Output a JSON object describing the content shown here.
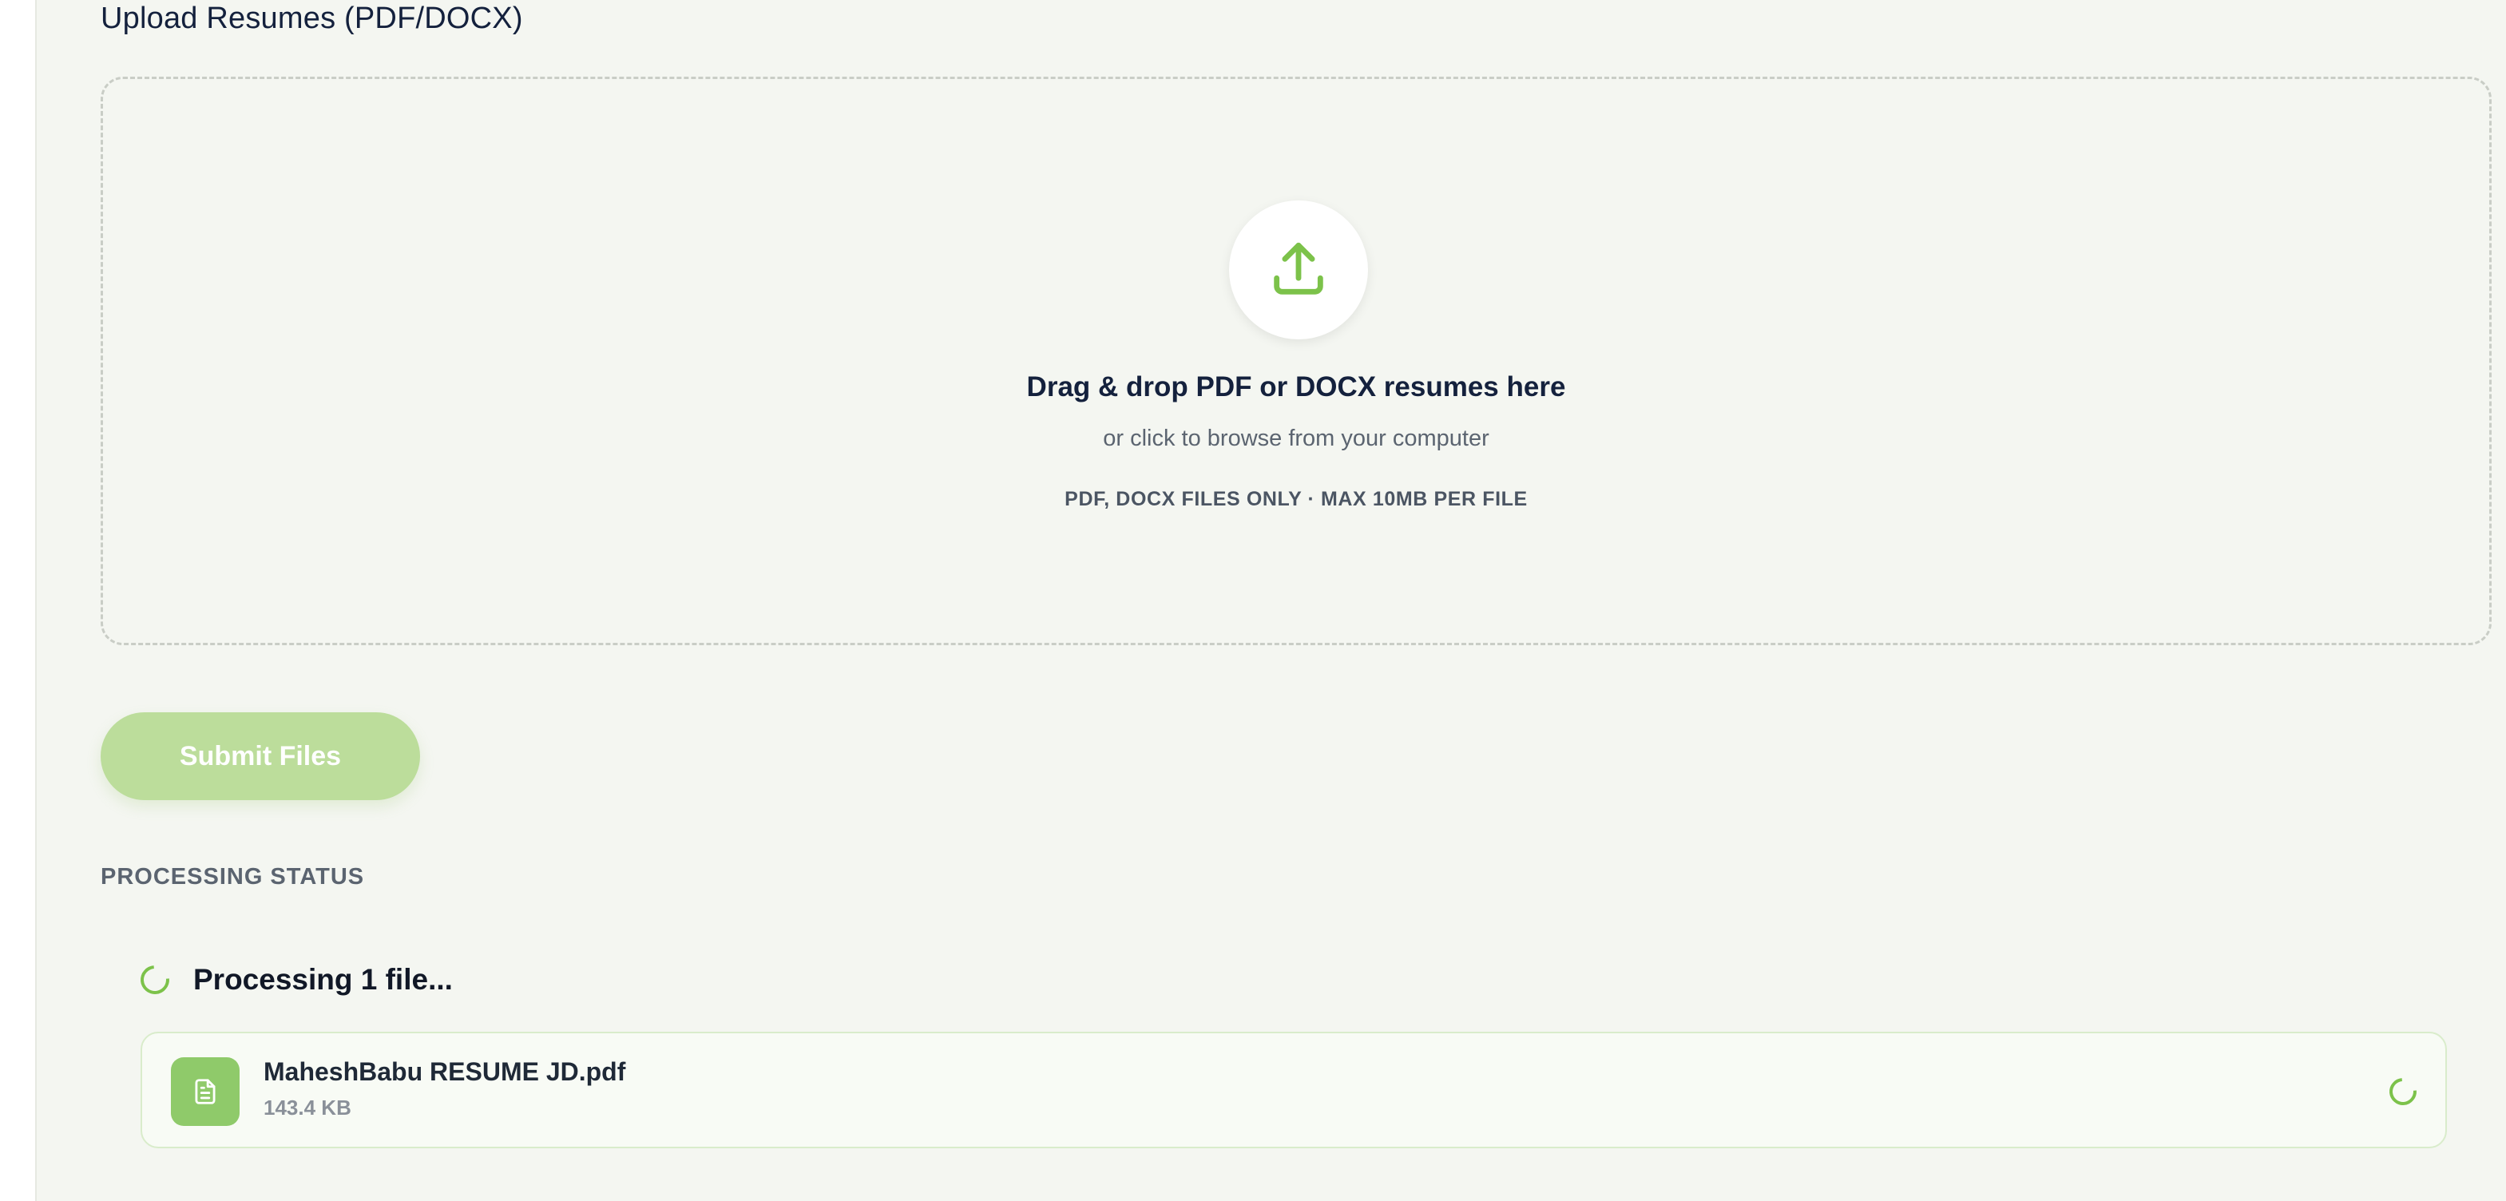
{
  "upload": {
    "section_title": "Upload Resumes (PDF/DOCX)",
    "dropzone_title": "Drag & drop PDF or DOCX resumes here",
    "dropzone_subtitle": "or click to browse from your computer",
    "dropzone_hint": "PDF, DOCX FILES ONLY · MAX 10MB PER FILE",
    "icon": "upload-icon"
  },
  "submit": {
    "label": "Submit Files",
    "state": "disabled"
  },
  "status": {
    "heading": "PROCESSING STATUS",
    "processing_text": "Processing 1 file...",
    "files": [
      {
        "name": "MaheshBabu RESUME JD.pdf",
        "size": "143.4 KB",
        "icon": "document-icon"
      }
    ]
  },
  "colors": {
    "accent": "#7cc24a",
    "submit_disabled_bg": "#bcdd9b",
    "background": "#f4f6f1",
    "text_dark": "#14213d"
  }
}
